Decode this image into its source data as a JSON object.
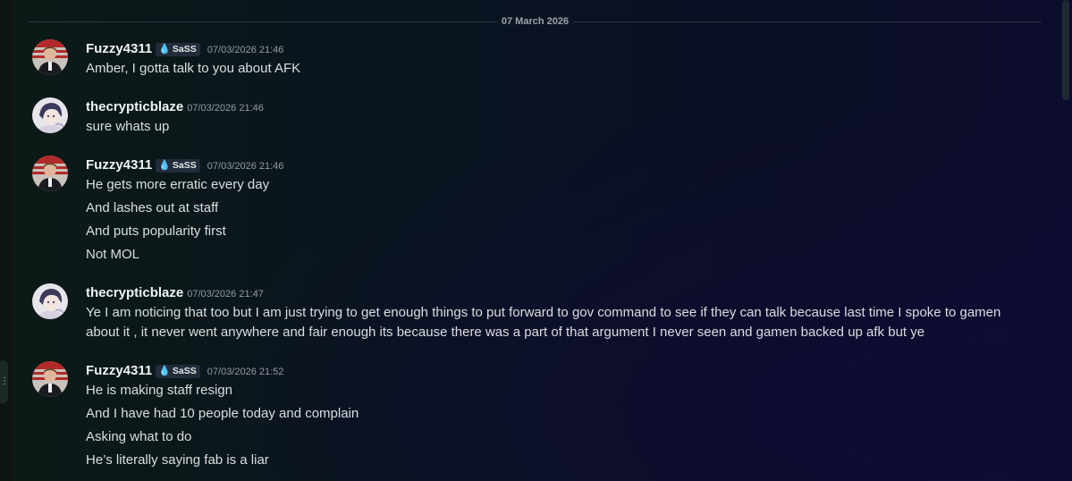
{
  "date_divider": "07 March 2026",
  "messages": [
    {
      "author": "Fuzzy4311",
      "tag": "SaSS",
      "timestamp": "07/03/2026 21:46",
      "lines": [
        "Amber, I gotta talk to you about AFK"
      ]
    },
    {
      "author": "thecrypticblaze",
      "timestamp": "07/03/2026 21:46",
      "lines": [
        "sure whats up"
      ]
    },
    {
      "author": "Fuzzy4311",
      "tag": "SaSS",
      "timestamp": "07/03/2026 21:46",
      "lines": [
        "He gets more erratic every day",
        "And lashes out at staff",
        "And puts popularity first",
        "Not MOL"
      ]
    },
    {
      "author": "thecrypticblaze",
      "timestamp": "07/03/2026 21:47",
      "lines": [
        "Ye I am noticing that too but I am just trying to get enough things to put forward to gov command to see if they can talk because last time I spoke to gamen about it , it never went anywhere and fair enough its because there was a part of that argument I never seen and gamen backed up afk but ye"
      ]
    },
    {
      "author": "Fuzzy4311",
      "tag": "SaSS",
      "timestamp": "07/03/2026 21:52",
      "lines": [
        "He is making staff resign",
        "And I have had 10 people today and complain",
        "Asking what to do",
        "He’s literally saying fab is a liar"
      ]
    }
  ]
}
